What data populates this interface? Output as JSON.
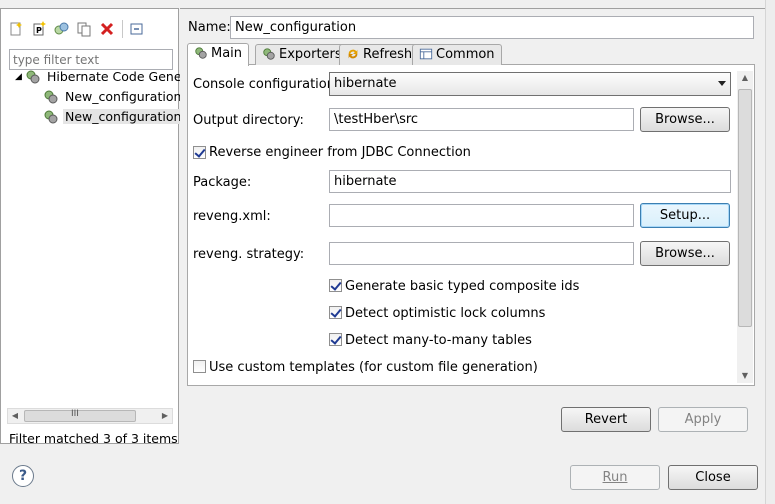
{
  "left": {
    "filter_placeholder": "type filter text",
    "tree": [
      {
        "label": "Hibernate Code Gene",
        "level": 0,
        "expanded": true
      },
      {
        "label": "New_configuration",
        "level": 1
      },
      {
        "label": "New_configuration",
        "level": 1,
        "selected": true
      }
    ],
    "status": "Filter matched 3 of 3 items",
    "scroll_thumb_glyph": "III"
  },
  "name": {
    "label": "Name:",
    "value": "New_configuration"
  },
  "tabs": [
    {
      "label": "Main",
      "active": true
    },
    {
      "label": "Exporters"
    },
    {
      "label": "Refresh"
    },
    {
      "label": "Common"
    }
  ],
  "main": {
    "console_label": "Console configuration:",
    "console_value": "hibernate",
    "output_label": "Output directory:",
    "output_value": "\\testHber\\src",
    "browse_label": "Browse...",
    "reverse_label": "Reverse engineer from JDBC Connection",
    "package_label": "Package:",
    "package_value": "hibernate",
    "reveng_label": "reveng.xml:",
    "setup_label": "Setup...",
    "strategy_label": "reveng. strategy:",
    "browse2_label": "Browse...",
    "opt1": "Generate basic typed composite ids",
    "opt2": "Detect optimistic lock columns",
    "opt3": "Detect many-to-many tables",
    "custom_templates": "Use custom templates (for custom file generation)"
  },
  "buttons": {
    "revert": "Revert",
    "apply": "Apply",
    "run": "Run",
    "close": "Close"
  },
  "help_glyph": "?"
}
